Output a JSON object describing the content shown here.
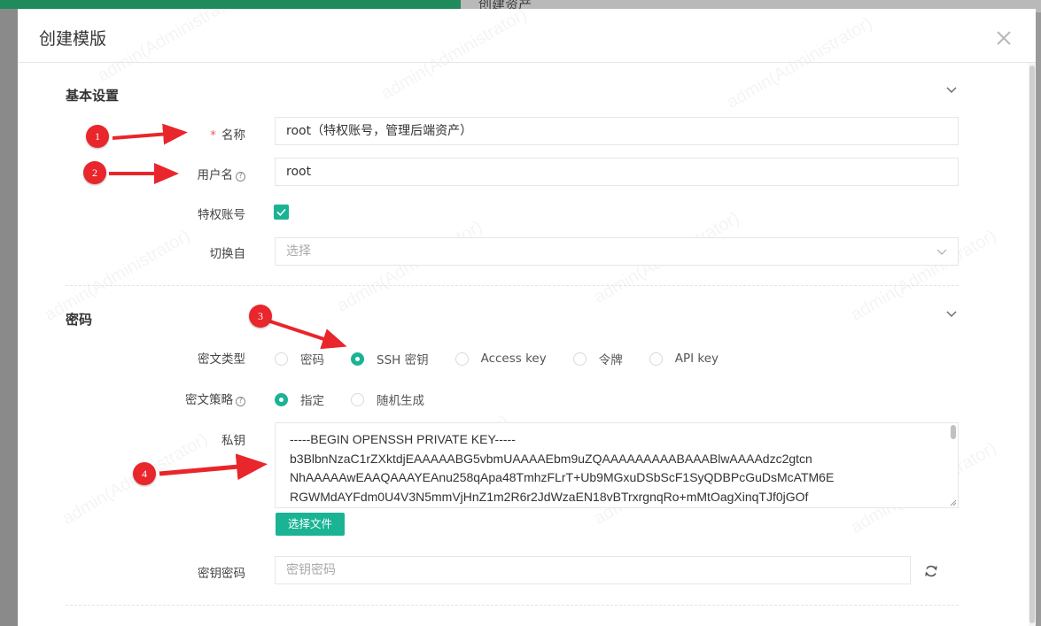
{
  "background": {
    "title": "创建资产"
  },
  "modal": {
    "title": "创建模版",
    "close_icon": "close-icon"
  },
  "basic": {
    "title": "基本设置",
    "name_label": "名称",
    "name_value": "root（特权账号，管理后端资产）",
    "username_label": "用户名",
    "username_value": "root",
    "privileged_label": "特权账号",
    "privileged_checked": true,
    "switch_label": "切换自",
    "switch_placeholder": "选择"
  },
  "secret": {
    "title": "密码",
    "type_label": "密文类型",
    "type_options": [
      "密码",
      "SSH 密钥",
      "Access key",
      "令牌",
      "API key"
    ],
    "type_selected": "SSH 密钥",
    "strategy_label": "密文策略",
    "strategy_options": [
      "指定",
      "随机生成"
    ],
    "strategy_selected": "指定",
    "key_label": "私钥",
    "key_lines": [
      "-----BEGIN OPENSSH PRIVATE KEY-----",
      "b3BlbnNzaC1rZXktdjEAAAAABG5vbmUAAAAEbm9uZQAAAAAAAAABAAABlwAAAAdzc2gtcn",
      "NhAAAAAwEAAQAAAYEAnu258qApa48TmhzFLrT+Ub9MGxuDSbScF1SyQDBPcGuDsMcATM6E",
      "RGWMdAYFdm0U4V3N5mmVjHnZ1m2R6r2JdWzaEN18vBTrxrgnqRo+mMtOagXinqTJf0jGOf"
    ],
    "file_button": "选择文件",
    "passphrase_label": "密钥密码",
    "passphrase_placeholder": "密钥密码"
  },
  "watermark": "admin(Administrator)",
  "annotations": [
    "1",
    "2",
    "3",
    "4"
  ],
  "colors": {
    "accent": "#1ab394",
    "marker": "#e8262b",
    "required": "#ed5565"
  }
}
